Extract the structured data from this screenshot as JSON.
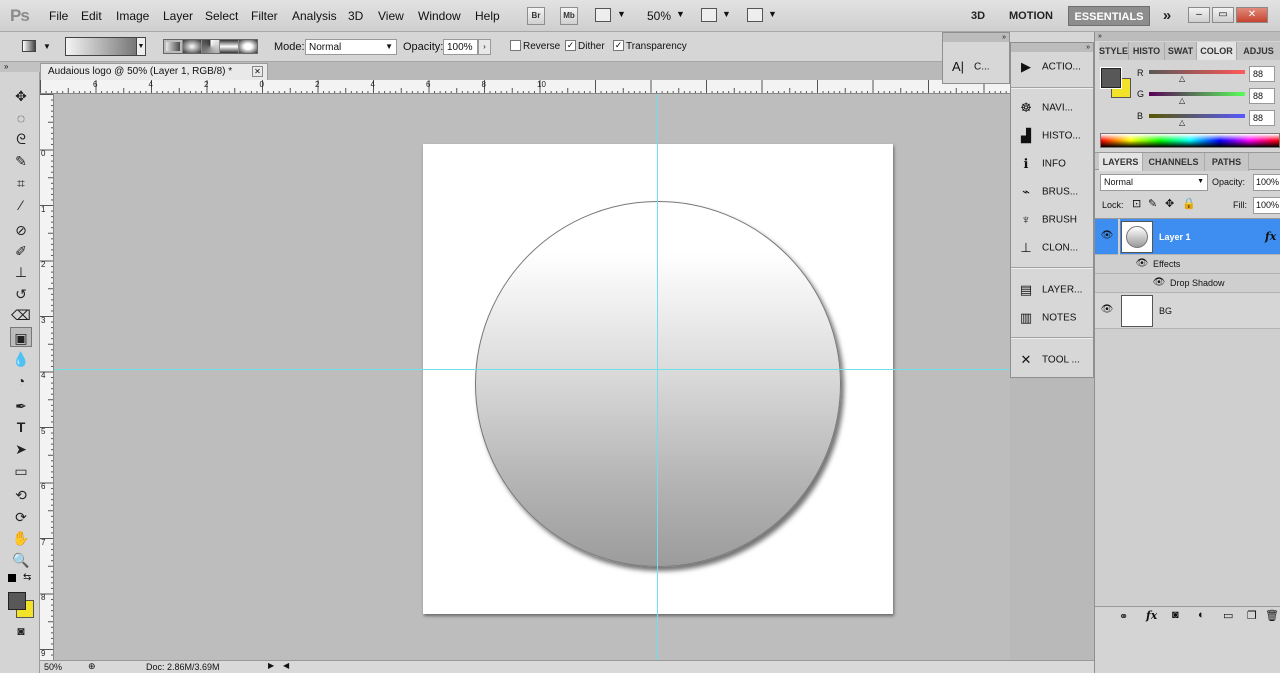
{
  "app": {
    "logo": "Ps",
    "menus": [
      "File",
      "Edit",
      "Image",
      "Layer",
      "Select",
      "Filter",
      "Analysis",
      "3D",
      "View",
      "Window",
      "Help"
    ],
    "bridge_label": "Br",
    "minibridge_label": "Mb",
    "zoom": "50%",
    "workspaces": [
      "3D",
      "MOTION",
      "ESSENTIALS"
    ],
    "workspace_more": "»",
    "window_buttons": [
      "–",
      "▭",
      "✕"
    ]
  },
  "options": {
    "mode_label": "Mode:",
    "mode_value": "Normal",
    "opacity_label": "Opacity:",
    "opacity_value": "100%",
    "reverse_label": "Reverse",
    "reverse_checked": false,
    "dither_label": "Dither",
    "dither_checked": true,
    "transparency_label": "Transparency",
    "transparency_checked": true
  },
  "document": {
    "tab_title": "Audaious logo @ 50% (Layer 1, RGB/8) *",
    "close": "✕",
    "ruler_top_labels": [
      "6",
      "4",
      "2",
      "0",
      "2",
      "4",
      "6",
      "8",
      "10"
    ],
    "ruler_left_labels": [
      "0",
      "1",
      "2",
      "3",
      "4",
      "5",
      "6",
      "7",
      "8",
      "9"
    ]
  },
  "status": {
    "zoom": "50%",
    "doc_size": "Doc: 2.86M/3.69M"
  },
  "dock_small": {
    "label": "C..."
  },
  "dock_panels": {
    "items": [
      "ACTIO...",
      "NAVI...",
      "HISTO...",
      "INFO",
      "BRUS...",
      "BRUSH",
      "CLON...",
      "LAYER...",
      "NOTES",
      "TOOL ..."
    ]
  },
  "color_panel": {
    "tabs": [
      "STYLE",
      "HISTO",
      "SWAT",
      "COLOR",
      "ADJUS"
    ],
    "active_tab": "COLOR",
    "r_label": "R",
    "g_label": "G",
    "b_label": "B",
    "r_value": "88",
    "g_value": "88",
    "b_value": "88",
    "foreground_color": "#585858",
    "background_color": "#f2e32a"
  },
  "layers_panel": {
    "tabs": [
      "LAYERS",
      "CHANNELS",
      "PATHS"
    ],
    "blend_mode": "Normal",
    "opacity_label": "Opacity:",
    "opacity_value": "100%",
    "lock_label": "Lock:",
    "fill_label": "Fill:",
    "fill_value": "100%",
    "layers": [
      {
        "name": "Layer 1",
        "selected": true,
        "fx": "fx"
      },
      {
        "name": "BG",
        "selected": false
      }
    ],
    "effects_label": "Effects",
    "drop_shadow_label": "Drop Shadow",
    "selection_color": "#3d8ef0"
  }
}
